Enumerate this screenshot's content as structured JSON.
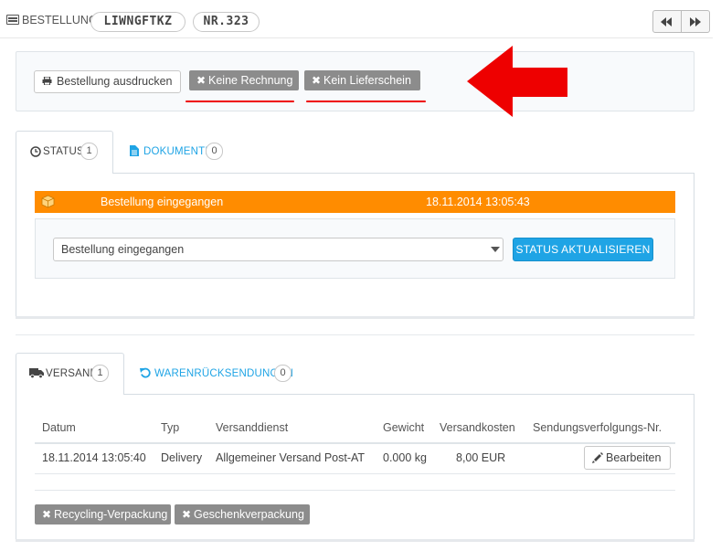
{
  "header": {
    "title": "BESTELLUNG",
    "reference": "LIWNGFTKZ",
    "order_number": "NR.323"
  },
  "actions": {
    "print_label": "Bestellung ausdrucken",
    "no_invoice_label": "Keine Rechnung",
    "no_delivery_slip_label": "Kein Lieferschein"
  },
  "status_tabs": [
    {
      "label": "STATUS",
      "count": "1",
      "icon": "clock-icon"
    },
    {
      "label": "DOKUMENTE",
      "count": "0",
      "icon": "file-icon"
    }
  ],
  "status_history": [
    {
      "status": "Bestellung eingegangen",
      "date": "18.11.2014 13:05:43",
      "color": "#ff8c00"
    }
  ],
  "status_form": {
    "selected": "Bestellung eingegangen",
    "update_label": "STATUS AKTUALISIEREN"
  },
  "shipping_tabs": [
    {
      "label": "VERSAND",
      "count": "1",
      "icon": "truck-icon"
    },
    {
      "label": "WARENRÜCKSENDUNGEN",
      "count": "0",
      "icon": "undo-icon"
    }
  ],
  "shipping_table": {
    "headers": [
      "Datum",
      "Typ",
      "Versanddienst",
      "Gewicht",
      "Versandkosten",
      "Sendungsverfolgungs-Nr."
    ],
    "rows": [
      {
        "date": "18.11.2014 13:05:40",
        "type": "Delivery",
        "carrier": "Allgemeiner Versand Post-AT",
        "weight": "0.000 kg",
        "cost": "8,00 EUR",
        "edit_label": "Bearbeiten"
      }
    ]
  },
  "extras": {
    "recycling_label": "Recycling-Verpackung",
    "gift_label": "Geschenkverpackung"
  },
  "colors": {
    "accent": "#1fa4e5",
    "status_orange": "#ff8c00",
    "annotation_red": "#ee0000",
    "disabled_gray": "#8c8c8c"
  }
}
